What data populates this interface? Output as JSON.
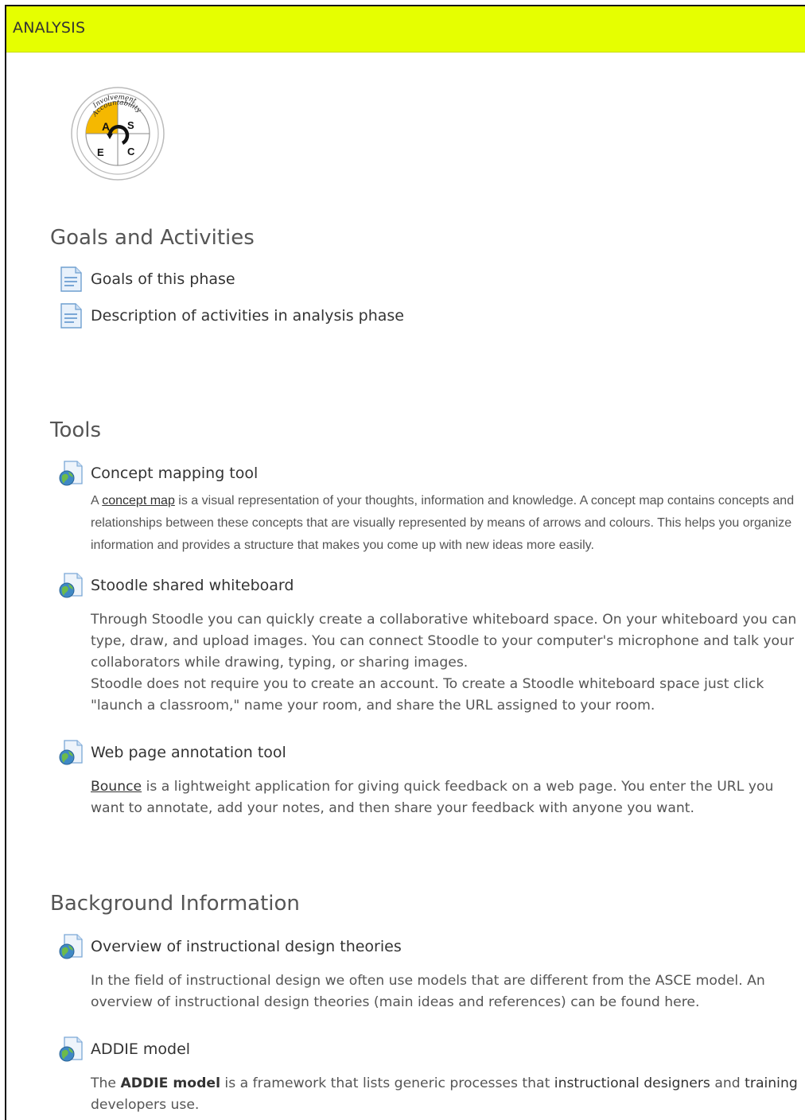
{
  "header": {
    "title": "ANALYSIS",
    "color": "#e6ff00"
  },
  "logo": {
    "icon": "asce-model-logo",
    "ring_text_outer": "Involvement",
    "ring_text_inner": "Accountability",
    "letters": [
      "A",
      "S",
      "E",
      "C"
    ],
    "accent": "#f5b800"
  },
  "sections": {
    "goals": {
      "title": "Goals and Activities",
      "items": [
        {
          "label": "Goals of this phase",
          "icon": "page-icon"
        },
        {
          "label": "Description of activities in analysis phase",
          "icon": "page-icon"
        }
      ]
    },
    "tools": {
      "title": "Tools",
      "items": [
        {
          "label": "Concept mapping tool",
          "icon": "web-link-icon",
          "desc_pre": "A ",
          "desc_link": "concept map",
          "desc_post": " is a visual representation of your thoughts, information and knowledge. A concept map contains concepts and relationships between these concepts that are visually represented by means of arrows and colours. This helps you organize information and provides a structure that makes you come up with new ideas more easily."
        },
        {
          "label": "Stoodle shared whiteboard",
          "icon": "web-link-icon",
          "desc_line1": "Through Stoodle you can quickly create a collaborative whiteboard space. On your whiteboard you can type, draw, and upload images. You can connect Stoodle to your computer's microphone and talk your collaborators while drawing, typing, or sharing images.",
          "desc_line2": "Stoodle does not require you to create an account. To create a Stoodle whiteboard space just click \"launch a classroom,\" name your room, and share the URL assigned to your room."
        },
        {
          "label": "Web page annotation tool",
          "icon": "web-link-icon",
          "desc_link": "Bounce",
          "desc_post": " is a lightweight application for giving quick feedback on a web page. You enter the URL you want to annotate, add your notes, and then share your feedback with anyone you want."
        }
      ]
    },
    "background": {
      "title": "Background Information",
      "items": [
        {
          "label": "Overview of instructional design theories",
          "icon": "web-link-icon",
          "desc": "In the field of instructional design we often use models that are different from the ASCE model. An overview of instructional design theories (main ideas and references) can be found here."
        },
        {
          "label": "ADDIE model",
          "icon": "web-link-icon",
          "desc_a": "The ",
          "desc_b": "ADDIE model",
          "desc_c": " is a framework that lists generic processes that ",
          "desc_d": "instructional designers",
          "desc_e": " and ",
          "desc_f": "training",
          "desc_g": " developers use."
        }
      ]
    }
  }
}
